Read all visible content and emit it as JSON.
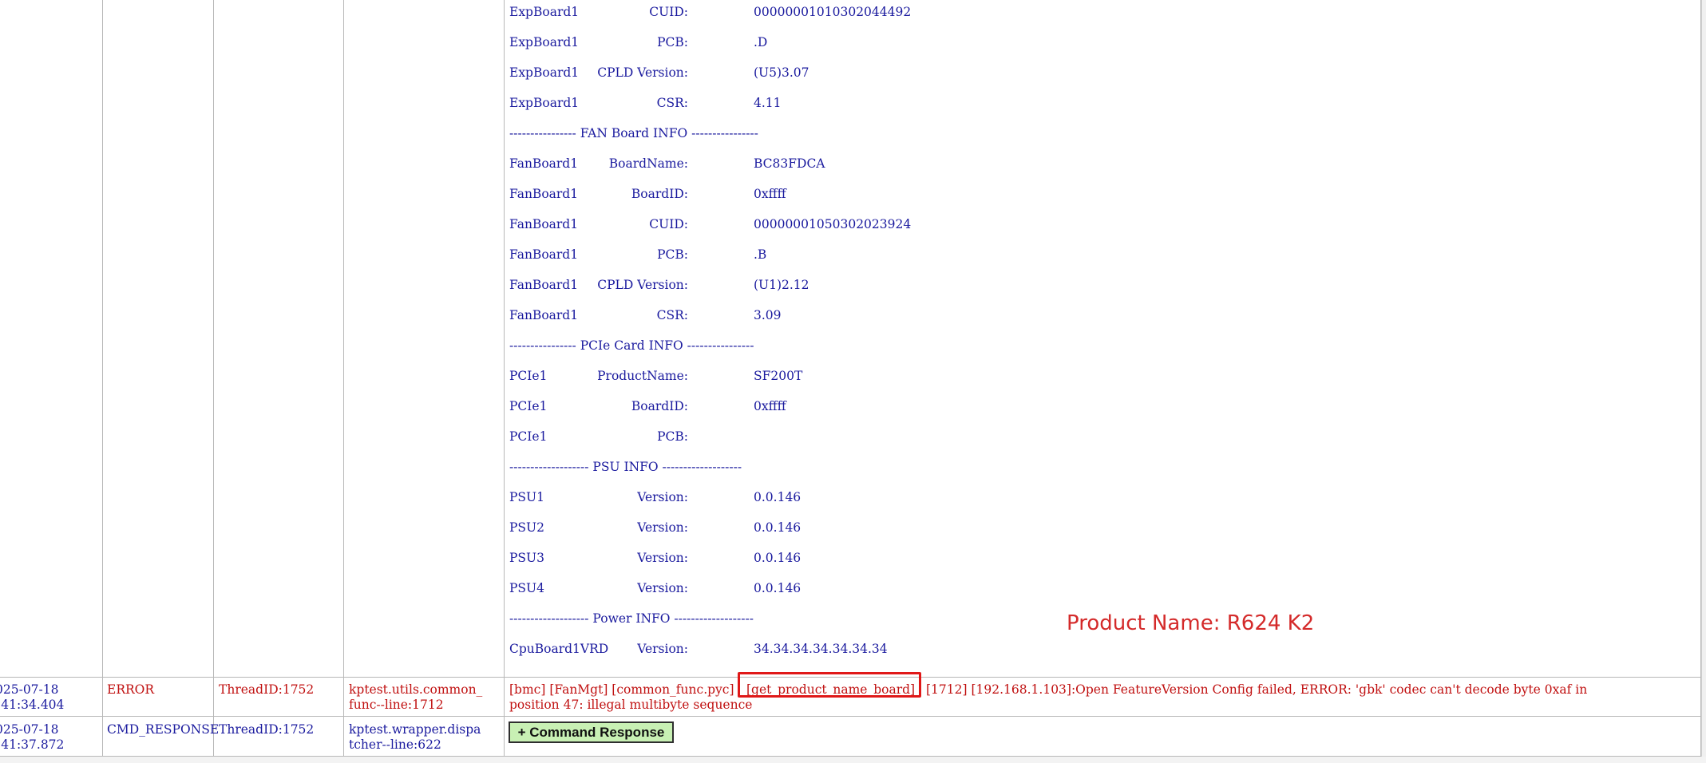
{
  "info_rows": [
    {
      "name": "ExpBoard1",
      "field": "CUID:",
      "value": "00000001010302044492"
    },
    {
      "name": "ExpBoard1",
      "field": "PCB:",
      "value": ".D"
    },
    {
      "name": "ExpBoard1",
      "field": "CPLD Version:",
      "value": "(U5)3.07"
    },
    {
      "name": "ExpBoard1",
      "field": "CSR:",
      "value": "4.11"
    },
    {
      "separator": "---------------- FAN Board INFO ----------------"
    },
    {
      "name": "FanBoard1",
      "field": "BoardName:",
      "value": "BC83FDCA"
    },
    {
      "name": "FanBoard1",
      "field": "BoardID:",
      "value": "0xffff"
    },
    {
      "name": "FanBoard1",
      "field": "CUID:",
      "value": "00000001050302023924"
    },
    {
      "name": "FanBoard1",
      "field": "PCB:",
      "value": ".B"
    },
    {
      "name": "FanBoard1",
      "field": "CPLD Version:",
      "value": "(U1)2.12"
    },
    {
      "name": "FanBoard1",
      "field": "CSR:",
      "value": "3.09"
    },
    {
      "separator": "---------------- PCIe Card INFO ----------------"
    },
    {
      "name": "PCIe1",
      "field": "ProductName:",
      "value": "SF200T"
    },
    {
      "name": "PCIe1",
      "field": "BoardID:",
      "value": "0xffff"
    },
    {
      "name": "PCIe1",
      "field": "PCB:",
      "value": ""
    },
    {
      "separator": "------------------- PSU INFO -------------------"
    },
    {
      "name": "PSU1",
      "field": "Version:",
      "value": "0.0.146"
    },
    {
      "name": "PSU2",
      "field": "Version:",
      "value": "0.0.146"
    },
    {
      "name": "PSU3",
      "field": "Version:",
      "value": "0.0.146"
    },
    {
      "name": "PSU4",
      "field": "Version:",
      "value": "0.0.146"
    },
    {
      "separator": "------------------- Power INFO -------------------"
    },
    {
      "name": "CpuBoard1VRD",
      "field": "Version:",
      "value": "34.34.34.34.34.34.34"
    }
  ],
  "annotation": "Product Name: R624 K2",
  "log_rows": [
    {
      "date": "025-07-18",
      "time": ":41:34.404",
      "level": "ERROR",
      "thread": "ThreadID:1752",
      "source_line1": "kptest.utils.common_",
      "source_line2": "func--line:1712",
      "msg_part1": "[bmc] [FanMgt] [common_func.pyc]",
      "msg_highlight": "[get_product_name_board]",
      "msg_part2": "[1712] [192.168.1.103]:Open FeatureVersion Config failed, ERROR: 'gbk' codec can't decode byte 0xaf in",
      "msg_line2": "position 47: illegal multibyte sequence"
    },
    {
      "date": "025-07-18",
      "time": ":41:37.872",
      "level": "CMD_RESPONSE",
      "thread": "ThreadID:1752",
      "source_line1": "kptest.wrapper.dispa",
      "source_line2": "tcher--line:622",
      "button_label": "+ Command Response"
    }
  ]
}
